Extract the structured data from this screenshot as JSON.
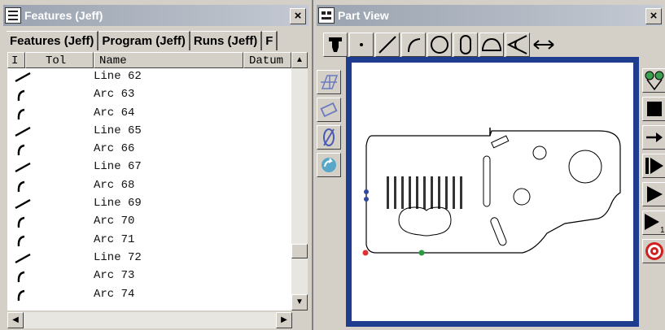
{
  "features_panel": {
    "title": "Features (Jeff)",
    "close_label": "×",
    "tabs": [
      "Features (Jeff)",
      "Program (Jeff)",
      "Runs (Jeff)",
      "F"
    ],
    "columns": [
      "I",
      "Tol",
      "Name",
      "Datum"
    ],
    "rows": [
      {
        "type": "line",
        "name": "Line 62"
      },
      {
        "type": "arc",
        "name": "Arc 63"
      },
      {
        "type": "arc",
        "name": "Arc 64"
      },
      {
        "type": "line",
        "name": "Line 65"
      },
      {
        "type": "arc",
        "name": "Arc 66"
      },
      {
        "type": "line",
        "name": "Line 67"
      },
      {
        "type": "arc",
        "name": "Arc 68"
      },
      {
        "type": "line",
        "name": "Line 69"
      },
      {
        "type": "arc",
        "name": "Arc 70"
      },
      {
        "type": "arc",
        "name": "Arc 71"
      },
      {
        "type": "line",
        "name": "Line 72"
      },
      {
        "type": "arc",
        "name": "Arc 73"
      },
      {
        "type": "arc",
        "name": "Arc 74"
      }
    ]
  },
  "part_view_panel": {
    "title": "Part View",
    "close_label": "×",
    "toolbar_icons": [
      "probe-icon",
      "point-icon",
      "line-icon",
      "arc-icon",
      "circle-icon",
      "slot-icon",
      "sector-icon",
      "angle-icon",
      "distance-icon"
    ],
    "left_tools": [
      "grid-plane-icon",
      "rectangle-icon",
      "ellipse-icon",
      "rotate-icon"
    ],
    "right_tools": [
      "fixture-icon",
      "stop-icon",
      "step-arrow-icon",
      "skip-forward-icon",
      "play-icon",
      "step-one-icon",
      "target-icon"
    ],
    "step_subscript": "1",
    "colors": {
      "frame": "#1f3d8f",
      "marker_red": "#e03030",
      "marker_green": "#2a9a40",
      "marker_blue": "#3048a0"
    }
  }
}
